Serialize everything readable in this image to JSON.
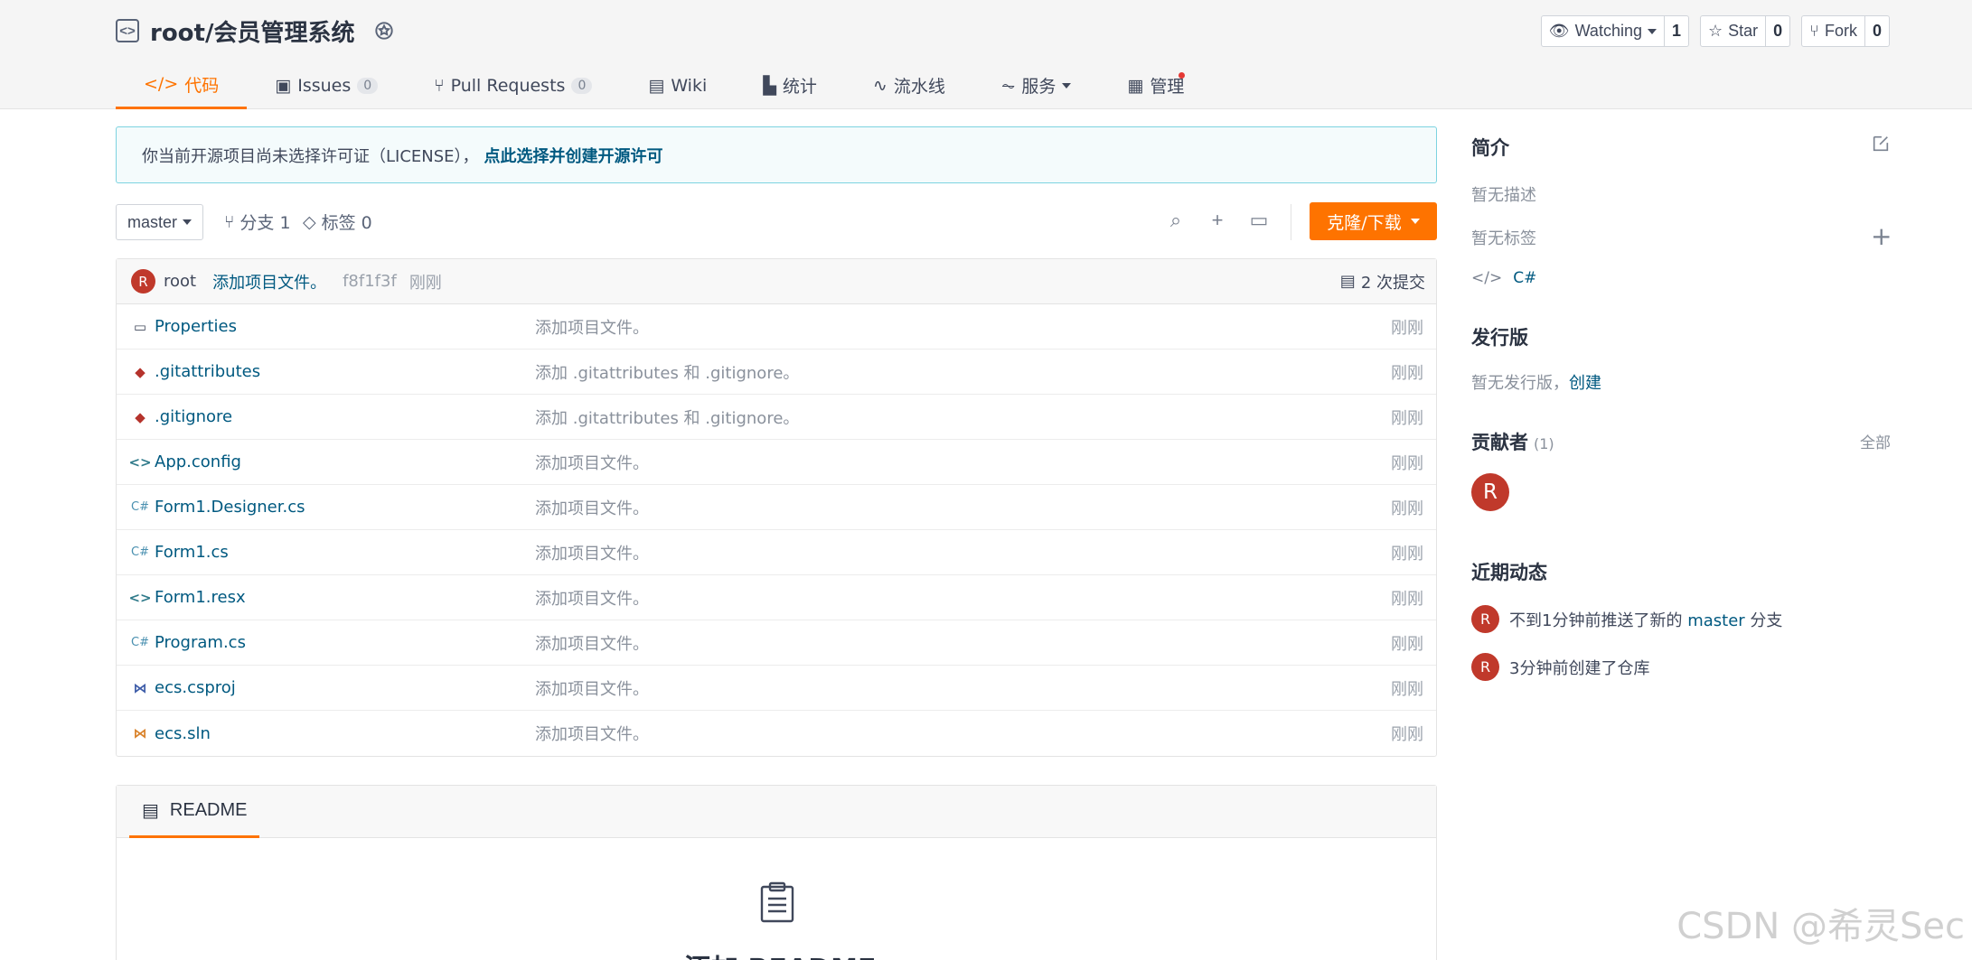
{
  "repo": {
    "title": "root/会员管理系统"
  },
  "actions": [
    {
      "label": "Watching",
      "count": "1",
      "icon": "eye-icon"
    },
    {
      "label": "Star",
      "count": "0",
      "icon": "star-icon"
    },
    {
      "label": "Fork",
      "count": "0",
      "icon": "fork-icon"
    }
  ],
  "tabs": {
    "code": "代码",
    "issues": "Issues",
    "issues_count": "0",
    "pulls": "Pull Requests",
    "pulls_count": "0",
    "wiki": "Wiki",
    "stats": "统计",
    "pipeline": "流水线",
    "services": "服务",
    "manage": "管理"
  },
  "notice": {
    "text": "你当前开源项目尚未选择许可证（LICENSE），",
    "link": "点此选择并创建开源许可"
  },
  "toolbar": {
    "branch": "master",
    "branches": "分支 1",
    "tags": "标签 0",
    "clone": "克隆/下载"
  },
  "commit": {
    "avatar": "R",
    "user": "root",
    "message": "添加项目文件。",
    "hash": "f8f1f3f",
    "time": "刚刚",
    "count": "2 次提交"
  },
  "files": [
    {
      "name": "Properties",
      "msg": "添加项目文件。",
      "time": "刚刚",
      "icon": "folder-icon"
    },
    {
      "name": ".gitattributes",
      "msg": "添加 .gitattributes 和 .gitignore。",
      "time": "刚刚",
      "icon": "git-icon"
    },
    {
      "name": ".gitignore",
      "msg": "添加 .gitattributes 和 .gitignore。",
      "time": "刚刚",
      "icon": "git-icon"
    },
    {
      "name": "App.config",
      "msg": "添加项目文件。",
      "time": "刚刚",
      "icon": "code-icon"
    },
    {
      "name": "Form1.Designer.cs",
      "msg": "添加项目文件。",
      "time": "刚刚",
      "icon": "csharp-icon"
    },
    {
      "name": "Form1.cs",
      "msg": "添加项目文件。",
      "time": "刚刚",
      "icon": "csharp-icon"
    },
    {
      "name": "Form1.resx",
      "msg": "添加项目文件。",
      "time": "刚刚",
      "icon": "code-icon"
    },
    {
      "name": "Program.cs",
      "msg": "添加项目文件。",
      "time": "刚刚",
      "icon": "csharp-icon"
    },
    {
      "name": "ecs.csproj",
      "msg": "添加项目文件。",
      "time": "刚刚",
      "icon": "vs-icon"
    },
    {
      "name": "ecs.sln",
      "msg": "添加项目文件。",
      "time": "刚刚",
      "icon": "vs-sln-icon"
    }
  ],
  "readme": {
    "tab": "README",
    "add": "添加 README"
  },
  "sidebar": {
    "intro_title": "简介",
    "no_desc": "暂无描述",
    "no_tags": "暂无标签",
    "language": "C#",
    "release_title": "发行版",
    "no_release": "暂无发行版，",
    "create": "创建",
    "contrib_title": "贡献者",
    "contrib_count": "(1)",
    "all": "全部",
    "contrib_avatar": "R",
    "activity_title": "近期动态",
    "activity1_pre": "不到1分钟前推送了新的",
    "activity1_branch": "master",
    "activity1_post": "分支",
    "activity2": "3分钟前创建了仓库"
  },
  "watermark": "CSDN @希灵Sec",
  "colors": {
    "accent": "#fe7300",
    "link": "#005980",
    "avatar": "#c0392b"
  }
}
